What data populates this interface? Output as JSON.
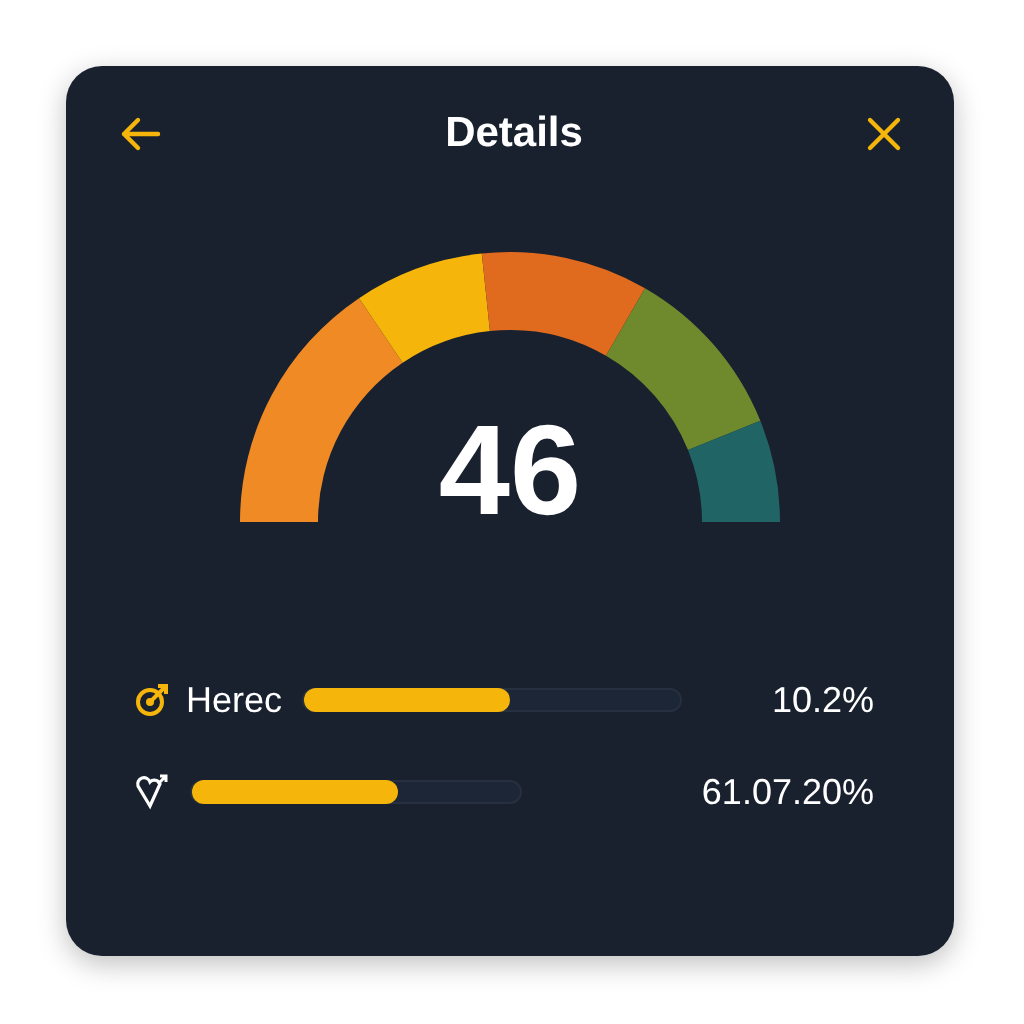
{
  "header": {
    "title": "Details"
  },
  "gauge": {
    "value": "46",
    "segments": [
      {
        "color": "#f08a24"
      },
      {
        "color": "#f5b50a"
      },
      {
        "color": "#e06b1e"
      },
      {
        "color": "#6e8a2c"
      },
      {
        "color": "#216466"
      }
    ]
  },
  "metrics": [
    {
      "label": "Herec",
      "level": 0.55,
      "reading": "10.2%"
    },
    {
      "level": 0.63,
      "reading": "61.07.20%"
    }
  ]
}
